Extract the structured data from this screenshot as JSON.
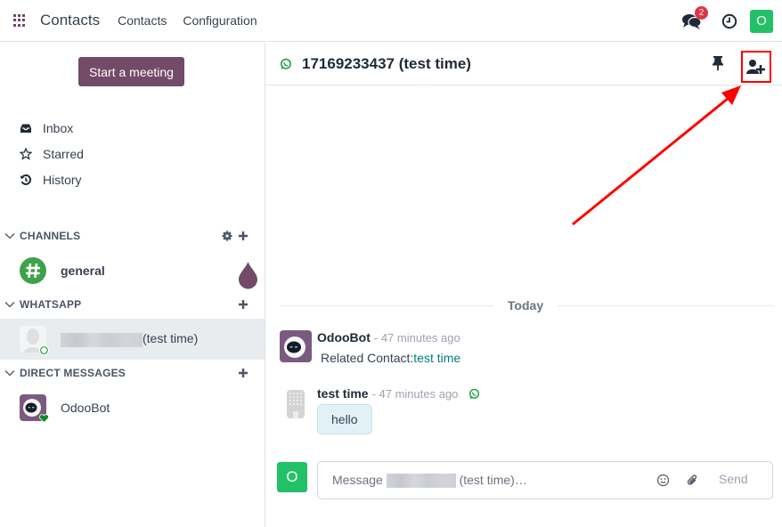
{
  "navbar": {
    "app_name": "Contacts",
    "menu": [
      "Contacts",
      "Configuration"
    ],
    "messages_badge": "2",
    "user_initial": "O",
    "icons": [
      "apps-grid-icon",
      "chat-bubbles-icon",
      "clock-icon"
    ]
  },
  "sidebar": {
    "start_meeting_label": "Start a meeting",
    "mailboxes": [
      {
        "label": "Inbox",
        "icon": "inbox-icon"
      },
      {
        "label": "Starred",
        "icon": "star-icon"
      },
      {
        "label": "History",
        "icon": "history-icon"
      }
    ],
    "categories": {
      "channels": {
        "label": "CHANNELS",
        "threads": [
          {
            "name": "general",
            "icon": "hashtag-icon"
          }
        ]
      },
      "whatsapp": {
        "label": "WHATSAPP",
        "threads": [
          {
            "name_suffix": "(test time)",
            "name_redacted": true,
            "active": true
          }
        ]
      },
      "direct_messages": {
        "label": "DIRECT MESSAGES",
        "threads": [
          {
            "name": "OdooBot",
            "status": "online"
          }
        ]
      }
    }
  },
  "thread": {
    "title": "17169233437 (test time)",
    "channel_type_icon": "whatsapp-icon",
    "header_actions": [
      "pin-icon",
      "add-users-icon"
    ],
    "date_separator": "Today",
    "messages": [
      {
        "author": "OdooBot",
        "time": "- 47 minutes ago",
        "body_prefix": "Related Contact:",
        "body_link": "test time"
      },
      {
        "author": "test time",
        "time": "- 47 minutes ago",
        "via_icon": "whatsapp-icon",
        "body": "hello"
      }
    ],
    "composer": {
      "avatar_initial": "O",
      "placeholder_prefix": "Message",
      "placeholder_suffix": "(test time)…",
      "send_label": "Send"
    }
  },
  "colors": {
    "brand": "#714b67",
    "success": "#22c067",
    "badge": "#dc3545",
    "link": "#017e84",
    "annotation": "#ff0000"
  }
}
